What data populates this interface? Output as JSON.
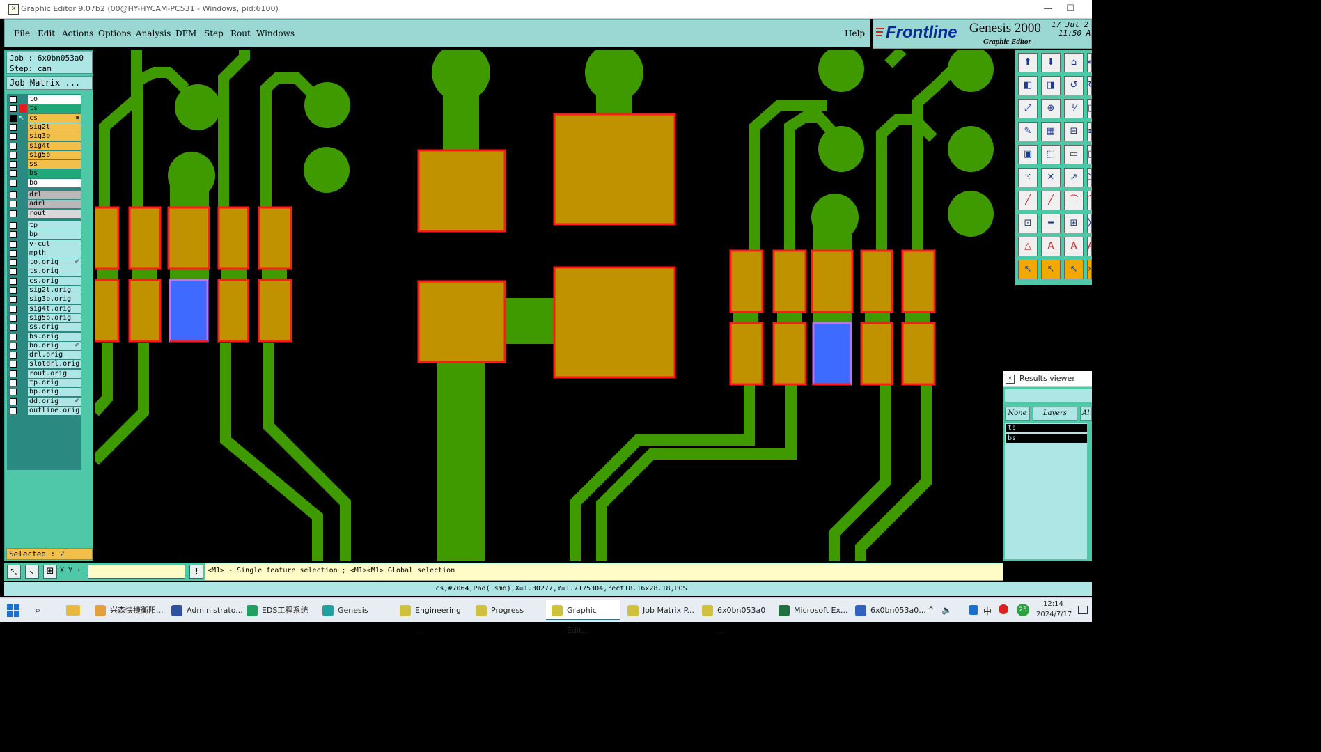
{
  "window": {
    "title": "Graphic Editor 9.07b2 (00@HY-HYCAM-PC531 - Windows, pid:6100)",
    "minimize": "—",
    "maximize": "☐"
  },
  "menu": {
    "items": [
      "File",
      "Edit",
      "Actions",
      "Options",
      "Analysis",
      "DFM",
      "Step",
      "Rout",
      "Windows"
    ],
    "help": "Help"
  },
  "brand": {
    "logo": "Frontline",
    "product": "Genesis 2000",
    "subtitle": "Graphic Editor",
    "date": "17 Jul 2",
    "time": "11:50 A"
  },
  "job": {
    "job_label": "Job : 6x0bn053a0",
    "step_label": "Step: cam",
    "matrix_button": "Job Matrix ..."
  },
  "layers": [
    {
      "name": "to",
      "color": "#ffffff",
      "checked": false,
      "state": ""
    },
    {
      "name": "ts",
      "color": "#20a878",
      "checked": false,
      "state": "red"
    },
    {
      "name": "cs",
      "color": "#f2c04a",
      "checked": true,
      "state": "work"
    },
    {
      "name": "sig2t",
      "color": "#f2c04a",
      "checked": false,
      "state": ""
    },
    {
      "name": "sig3b",
      "color": "#f2c04a",
      "checked": false,
      "state": ""
    },
    {
      "name": "sig4t",
      "color": "#f2c04a",
      "checked": false,
      "state": ""
    },
    {
      "name": "sig5b",
      "color": "#f2c04a",
      "checked": false,
      "state": ""
    },
    {
      "name": "ss",
      "color": "#f2c04a",
      "checked": false,
      "state": ""
    },
    {
      "name": "bs",
      "color": "#20a878",
      "checked": false,
      "state": ""
    },
    {
      "name": "bo",
      "color": "#ffffff",
      "checked": false,
      "state": ""
    },
    {
      "name": "drl",
      "color": "#b8b8b8",
      "checked": false,
      "state": "gap"
    },
    {
      "name": "adrl",
      "color": "#b8b8b8",
      "checked": false,
      "state": ""
    },
    {
      "name": "rout",
      "color": "#d8d8d8",
      "checked": false,
      "state": ""
    },
    {
      "name": "tp",
      "color": "#aee6e6",
      "checked": false,
      "state": "gap"
    },
    {
      "name": "bp",
      "color": "#aee6e6",
      "checked": false,
      "state": ""
    },
    {
      "name": "v-cut",
      "color": "#aee6e6",
      "checked": false,
      "state": ""
    },
    {
      "name": "mpth",
      "color": "#aee6e6",
      "checked": false,
      "state": ""
    },
    {
      "name": "to.orig",
      "color": "#aee6e6",
      "checked": false,
      "state": "mark"
    },
    {
      "name": "ts.orig",
      "color": "#aee6e6",
      "checked": false,
      "state": ""
    },
    {
      "name": "cs.orig",
      "color": "#aee6e6",
      "checked": false,
      "state": ""
    },
    {
      "name": "sig2t.orig",
      "color": "#aee6e6",
      "checked": false,
      "state": ""
    },
    {
      "name": "sig3b.orig",
      "color": "#aee6e6",
      "checked": false,
      "state": ""
    },
    {
      "name": "sig4t.orig",
      "color": "#aee6e6",
      "checked": false,
      "state": ""
    },
    {
      "name": "sig5b.orig",
      "color": "#aee6e6",
      "checked": false,
      "state": ""
    },
    {
      "name": "ss.orig",
      "color": "#aee6e6",
      "checked": false,
      "state": ""
    },
    {
      "name": "bs.orig",
      "color": "#aee6e6",
      "checked": false,
      "state": ""
    },
    {
      "name": "bo.orig",
      "color": "#aee6e6",
      "checked": false,
      "state": "mark"
    },
    {
      "name": "drl.orig",
      "color": "#aee6e6",
      "checked": false,
      "state": ""
    },
    {
      "name": "slotdrl.orig",
      "color": "#aee6e6",
      "checked": false,
      "state": ""
    },
    {
      "name": "rout.orig",
      "color": "#aee6e6",
      "checked": false,
      "state": ""
    },
    {
      "name": "tp.orig",
      "color": "#aee6e6",
      "checked": false,
      "state": ""
    },
    {
      "name": "bp.orig",
      "color": "#aee6e6",
      "checked": false,
      "state": ""
    },
    {
      "name": "dd.orig",
      "color": "#aee6e6",
      "checked": false,
      "state": "mark"
    },
    {
      "name": "outline.orig",
      "color": "#aee6e6",
      "checked": false,
      "state": ""
    }
  ],
  "selected": "Selected : 2",
  "command": {
    "xy_label": "X Y :",
    "xy_value": "",
    "prompt": "<M1> - Single feature selection ; <M1><M1> Global selection"
  },
  "status": "cs,#7064,Pad(.smd),X=1.30277,Y=1.7175304,rect18.16x28.18,POS",
  "results_viewer": {
    "title": "Results viewer",
    "tabs": [
      "None",
      "Layers",
      "Al"
    ],
    "items": [
      "ts",
      "bs"
    ]
  },
  "colors": {
    "trace": "#3f9a00",
    "pad": "#c09200",
    "outline": "#ff1a1a",
    "highlight": "#3f6aff",
    "panel": "#4fc8a8",
    "menubar": "#9bd8d4"
  },
  "taskbar": {
    "items": [
      {
        "label": "兴森快捷衡阳...",
        "icon": "#e0a040"
      },
      {
        "label": "Administrato...",
        "icon": "#3050a0"
      },
      {
        "label": "EDS工程系统",
        "icon": "#20a060"
      },
      {
        "label": "Genesis",
        "icon": "#20a0a0"
      },
      {
        "label": "Engineering ...",
        "icon": "#d0c040"
      },
      {
        "label": "Progress",
        "icon": "#d0c040"
      },
      {
        "label": "Graphic Edit...",
        "icon": "#d0c040"
      },
      {
        "label": "Job Matrix P...",
        "icon": "#d0c040"
      },
      {
        "label": "6x0bn053a0 ...",
        "icon": "#d0c040"
      },
      {
        "label": "Microsoft Ex...",
        "icon": "#207040"
      },
      {
        "label": "6x0bn053a0...",
        "icon": "#3060c0"
      }
    ],
    "time": "12:14",
    "date": "2024/7/17",
    "ime": "中",
    "badge": "25"
  }
}
